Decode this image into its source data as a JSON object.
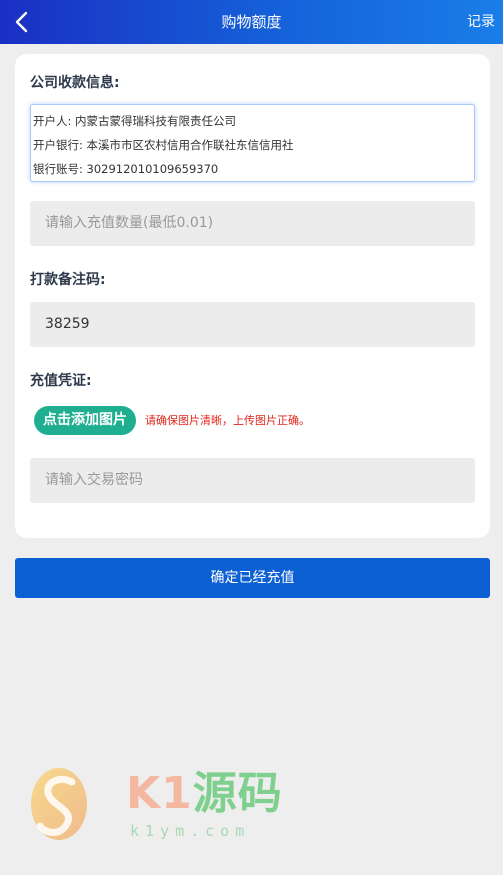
{
  "header": {
    "title": "购物额度",
    "record_label": "记录"
  },
  "company_info": {
    "label": "公司收款信息:",
    "lines": [
      "开户人: 内蒙古蒙得瑞科技有限责任公司",
      "开户银行: 本溪市市区农村信用合作联社东信信用社",
      "银行账号: 302912010109659370"
    ]
  },
  "amount_input": {
    "placeholder": "请输入充值数量(最低0.01)",
    "value": ""
  },
  "remark": {
    "label": "打款备注码:",
    "value": "38259"
  },
  "voucher": {
    "label": "充值凭证:",
    "upload_label": "点击添加图片",
    "tip": "请确保图片清晰，上传图片正确。"
  },
  "password_input": {
    "placeholder": "请输入交易密码",
    "value": ""
  },
  "confirm_label": "确定已经充值",
  "watermark": {
    "brand_k1": "K1",
    "brand_cn": "源码",
    "url": "k1ym.com"
  },
  "colors": {
    "header_gradient_start": "#1a2fc4",
    "header_gradient_end": "#1a7ee8",
    "confirm_button": "#0d60d3",
    "upload_button": "#1fae8f",
    "tip_text": "#e0271a",
    "background": "#eeeeee"
  },
  "icons": {
    "back": "chevron-left-icon",
    "watermark_logo": "k1-logo-icon"
  }
}
